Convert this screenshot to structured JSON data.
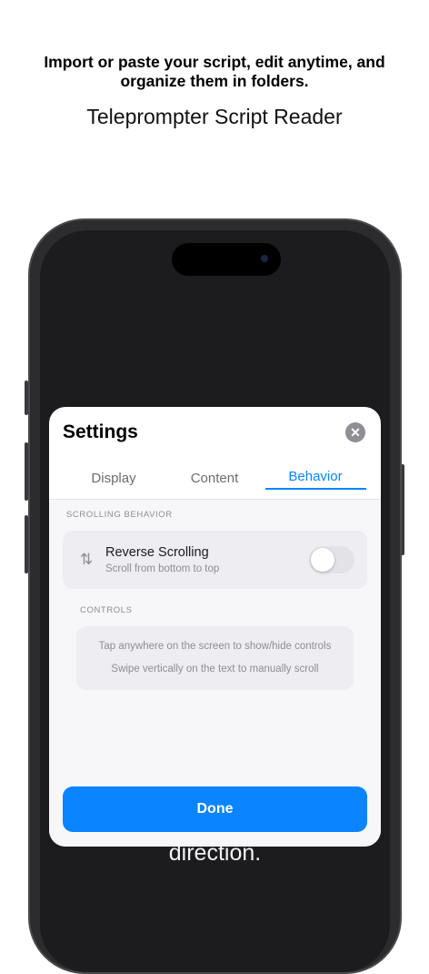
{
  "promo": {
    "headline": "Import or paste your script, edit anytime, and organize them in folders.",
    "subheadline": "Teleprompter Script Reader"
  },
  "background_text": "direction.",
  "settings": {
    "title": "Settings",
    "close_icon": "xmark-circle-icon",
    "tabs": [
      {
        "label": "Display",
        "active": false
      },
      {
        "label": "Content",
        "active": false
      },
      {
        "label": "Behavior",
        "active": true
      }
    ],
    "scrolling_behavior": {
      "section_label": "SCROLLING BEHAVIOR",
      "reverse_scrolling": {
        "icon": "arrow-up-arrow-down-icon",
        "title": "Reverse Scrolling",
        "subtitle": "Scroll from bottom to top",
        "enabled": false
      }
    },
    "controls": {
      "section_label": "CONTROLS",
      "tips": [
        "Tap anywhere on the screen to show/hide controls",
        "Swipe vertically on the text to manually scroll"
      ]
    },
    "done_label": "Done"
  },
  "colors": {
    "accent": "#0a84ff",
    "toggle_off": "#e2e2e7",
    "secondary_text": "#8e8e93"
  }
}
